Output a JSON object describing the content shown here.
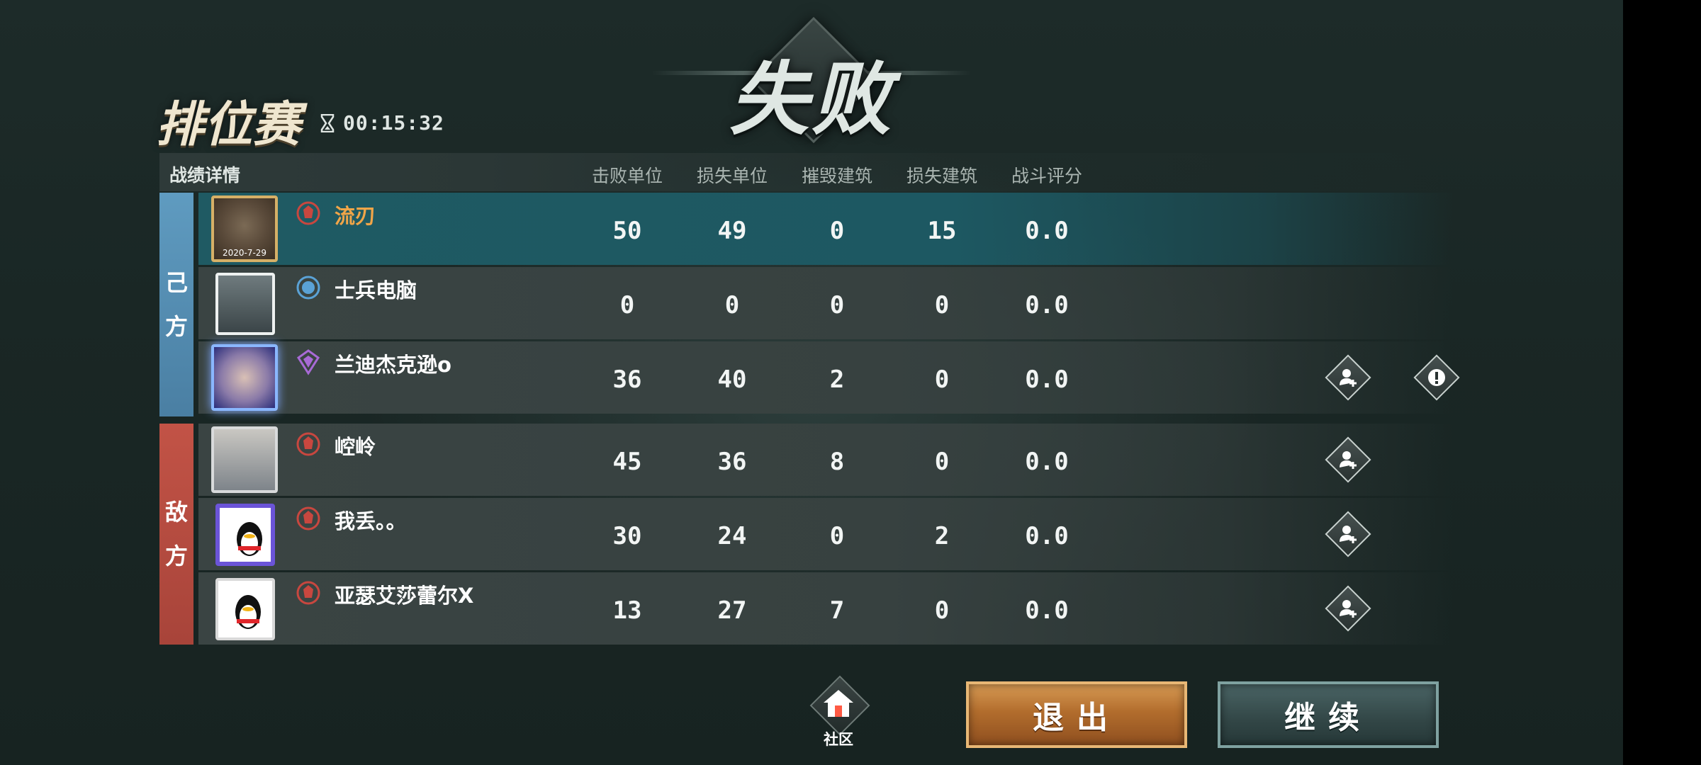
{
  "result": {
    "title": "失败"
  },
  "mode": {
    "title": "排位赛",
    "timer": "00:15:32"
  },
  "table": {
    "header_label": "战绩详情",
    "columns": [
      "击败单位",
      "损失单位",
      "摧毁建筑",
      "损失建筑",
      "战斗评分"
    ]
  },
  "teams": {
    "ally_label_1": "己",
    "ally_label_2": "方",
    "enemy_label_1": "敌",
    "enemy_label_2": "方"
  },
  "players": [
    {
      "name": "流刃",
      "avatar_caption": "2020-7-29",
      "kills": "50",
      "losses": "49",
      "destroyed": "0",
      "lost_buildings": "15",
      "score": "0.0",
      "rank_icon": "red-rank-icon",
      "self": true
    },
    {
      "name": "士兵电脑",
      "kills": "0",
      "losses": "0",
      "destroyed": "0",
      "lost_buildings": "0",
      "score": "0.0",
      "rank_icon": "blue-rank-icon"
    },
    {
      "name": "兰迪杰克逊o",
      "kills": "36",
      "losses": "40",
      "destroyed": "2",
      "lost_buildings": "0",
      "score": "0.0",
      "rank_icon": "purple-rank-icon"
    },
    {
      "name": "崆岭",
      "kills": "45",
      "losses": "36",
      "destroyed": "8",
      "lost_buildings": "0",
      "score": "0.0",
      "rank_icon": "red-rank-icon"
    },
    {
      "name": "我丢。。",
      "kills": "30",
      "losses": "24",
      "destroyed": "0",
      "lost_buildings": "2",
      "score": "0.0",
      "rank_icon": "red-rank-icon"
    },
    {
      "name": "亚瑟艾莎蕾尔X",
      "kills": "13",
      "losses": "27",
      "destroyed": "7",
      "lost_buildings": "0",
      "score": "0.0",
      "rank_icon": "red-rank-icon"
    }
  ],
  "bottom": {
    "community_label": "社区",
    "exit_label": "退出",
    "continue_label": "继续"
  },
  "colors": {
    "ally": "#5f9bc0",
    "enemy": "#c25346",
    "self_row": "#1f5a63",
    "self_name": "#f0a548"
  }
}
